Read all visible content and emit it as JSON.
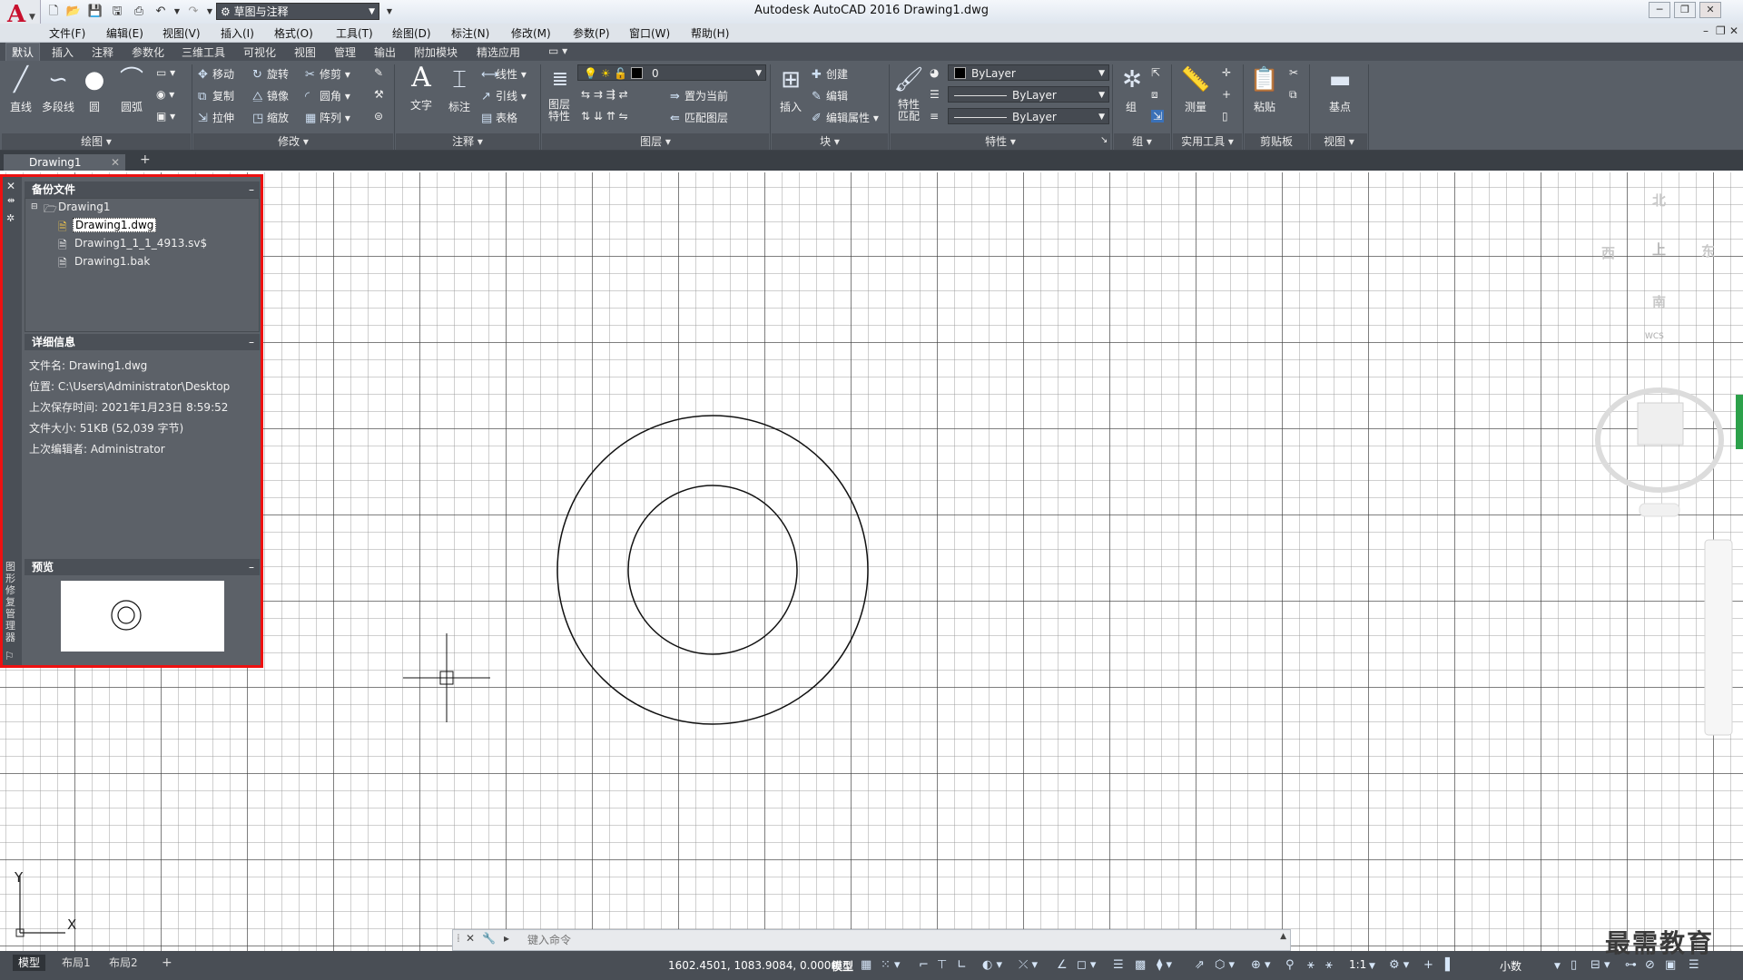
{
  "title_bar": {
    "workspace": "草图与注释",
    "app_title": "Autodesk AutoCAD 2016    Drawing1.dwg"
  },
  "menu": [
    "文件(F)",
    "编辑(E)",
    "视图(V)",
    "插入(I)",
    "格式(O)",
    "工具(T)",
    "绘图(D)",
    "标注(N)",
    "修改(M)",
    "参数(P)",
    "窗口(W)",
    "帮助(H)"
  ],
  "ribbon_tabs": [
    "默认",
    "插入",
    "注释",
    "参数化",
    "三维工具",
    "可视化",
    "视图",
    "管理",
    "输出",
    "附加模块",
    "精选应用"
  ],
  "ribbon": {
    "draw": {
      "line": "直线",
      "polyline": "多段线",
      "circle": "圆",
      "arc": "圆弧",
      "title": "绘图"
    },
    "modify": {
      "move": "移动",
      "rotate": "旋转",
      "trim": "修剪",
      "copy": "复制",
      "mirror": "镜像",
      "fillet": "圆角",
      "stretch": "拉伸",
      "scale": "缩放",
      "array": "阵列",
      "title": "修改"
    },
    "annotation": {
      "text": "文字",
      "dimension": "标注",
      "linear": "线性",
      "leader": "引线",
      "table": "表格",
      "title": "注释"
    },
    "layers": {
      "layer_props": "图层特性",
      "layer_value": "0",
      "set_current": "置为当前",
      "match_layer": "匹配图层",
      "title": "图层"
    },
    "block": {
      "insert": "插入",
      "create": "创建",
      "edit": "编辑",
      "edit_attr": "编辑属性",
      "title": "块"
    },
    "properties": {
      "match": "特性匹配",
      "color": "ByLayer",
      "linetype": "ByLayer",
      "lineweight": "ByLayer",
      "title": "特性"
    },
    "groups": {
      "group": "组",
      "title": "组"
    },
    "utilities": {
      "measure": "测量",
      "title": "实用工具"
    },
    "clipboard": {
      "paste": "粘贴",
      "title": "剪贴板"
    },
    "view": {
      "base": "基点",
      "title": "视图"
    }
  },
  "file_tab": "Drawing1",
  "palette": {
    "backup_header": "备份文件",
    "tree_root": "Drawing1",
    "files": [
      "Drawing1.dwg",
      "Drawing1_1_1_4913.sv$",
      "Drawing1.bak"
    ],
    "details_header": "详细信息",
    "details": [
      "文件名: Drawing1.dwg",
      "位置: C:\\Users\\Administrator\\Desktop",
      "上次保存时间: 2021年1月23日   8:59:52",
      "文件大小: 51KB (52,039 字节)",
      "上次编辑者: Administrator"
    ],
    "preview_header": "预览",
    "side_label": "图形修复管理器"
  },
  "navcube": {
    "north": "北",
    "south": "南",
    "east": "东",
    "west": "西",
    "top": "上",
    "wcs": "WCS"
  },
  "ucs": {
    "x": "X",
    "y": "Y"
  },
  "command": {
    "placeholder": "键入命令"
  },
  "layout_tabs": [
    "模型",
    "布局1",
    "布局2"
  ],
  "status": {
    "coords": "1602.4501, 1083.9084, 0.0000",
    "model": "模型",
    "scale": "1:1",
    "units": "小数"
  },
  "watermark": "最需教育"
}
